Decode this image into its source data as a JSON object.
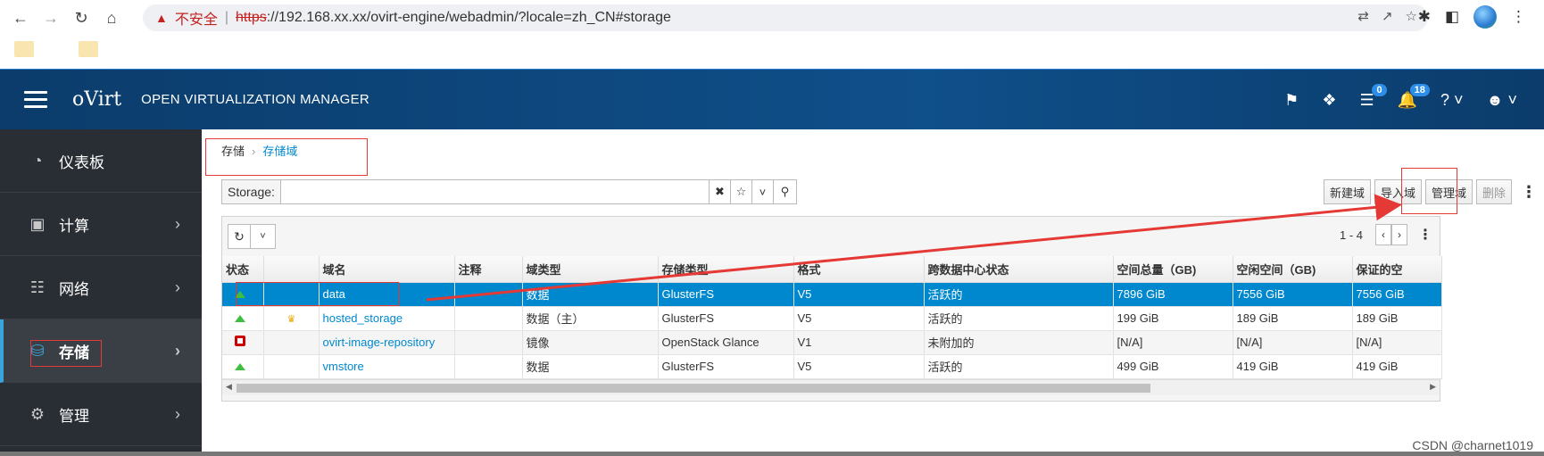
{
  "browser": {
    "warning": "不安全",
    "separator": "|",
    "url_scheme": "https",
    "url_rest": "://192.168.xx.xx/ovirt-engine/webadmin/?locale=zh_CN#storage"
  },
  "header": {
    "brand": "oVirt",
    "product": "OPEN VIRTUALIZATION MANAGER",
    "tasks_count": "0",
    "alerts_count": "18"
  },
  "sidebar": {
    "items": [
      {
        "label": "仪表板",
        "icon": "dashboard-icon"
      },
      {
        "label": "计算",
        "icon": "compute-icon"
      },
      {
        "label": "网络",
        "icon": "network-icon"
      },
      {
        "label": "存储",
        "icon": "storage-icon"
      },
      {
        "label": "管理",
        "icon": "gear-icon"
      }
    ]
  },
  "breadcrumb": {
    "parent": "存储",
    "current": "存储域"
  },
  "search": {
    "label": "Storage:",
    "value": ""
  },
  "actions": {
    "new": "新建域",
    "import": "导入域",
    "manage": "管理域",
    "remove": "删除"
  },
  "pager": {
    "range": "1 - 4"
  },
  "table": {
    "headers": [
      "状态",
      "",
      "域名",
      "注释",
      "域类型",
      "存储类型",
      "格式",
      "跨数据中心状态",
      "空间总量（GB)",
      "空闲空间（GB)",
      "保证的空"
    ],
    "rows": [
      {
        "name": "data",
        "comment": "",
        "domain_type": "数据",
        "storage_type": "GlusterFS",
        "format": "V5",
        "cross_dc": "活跃的",
        "total": "7896 GiB",
        "free": "7556 GiB",
        "guaranteed": "7556 GiB"
      },
      {
        "name": "hosted_storage",
        "comment": "",
        "domain_type": "数据（主）",
        "storage_type": "GlusterFS",
        "format": "V5",
        "cross_dc": "活跃的",
        "total": "199 GiB",
        "free": "189 GiB",
        "guaranteed": "189 GiB"
      },
      {
        "name": "ovirt-image-repository",
        "comment": "",
        "domain_type": "镜像",
        "storage_type": "OpenStack Glance",
        "format": "V1",
        "cross_dc": "未附加的",
        "total": "[N/A]",
        "free": "[N/A]",
        "guaranteed": "[N/A]"
      },
      {
        "name": "vmstore",
        "comment": "",
        "domain_type": "数据",
        "storage_type": "GlusterFS",
        "format": "V5",
        "cross_dc": "活跃的",
        "total": "499 GiB",
        "free": "419 GiB",
        "guaranteed": "419 GiB"
      }
    ]
  },
  "watermark": "CSDN @charnet1019",
  "accent_colors": {
    "header": "#0b3c6b",
    "selected_row": "#0088ce",
    "sidebar": "#292e34",
    "annotation": "#e53935"
  }
}
